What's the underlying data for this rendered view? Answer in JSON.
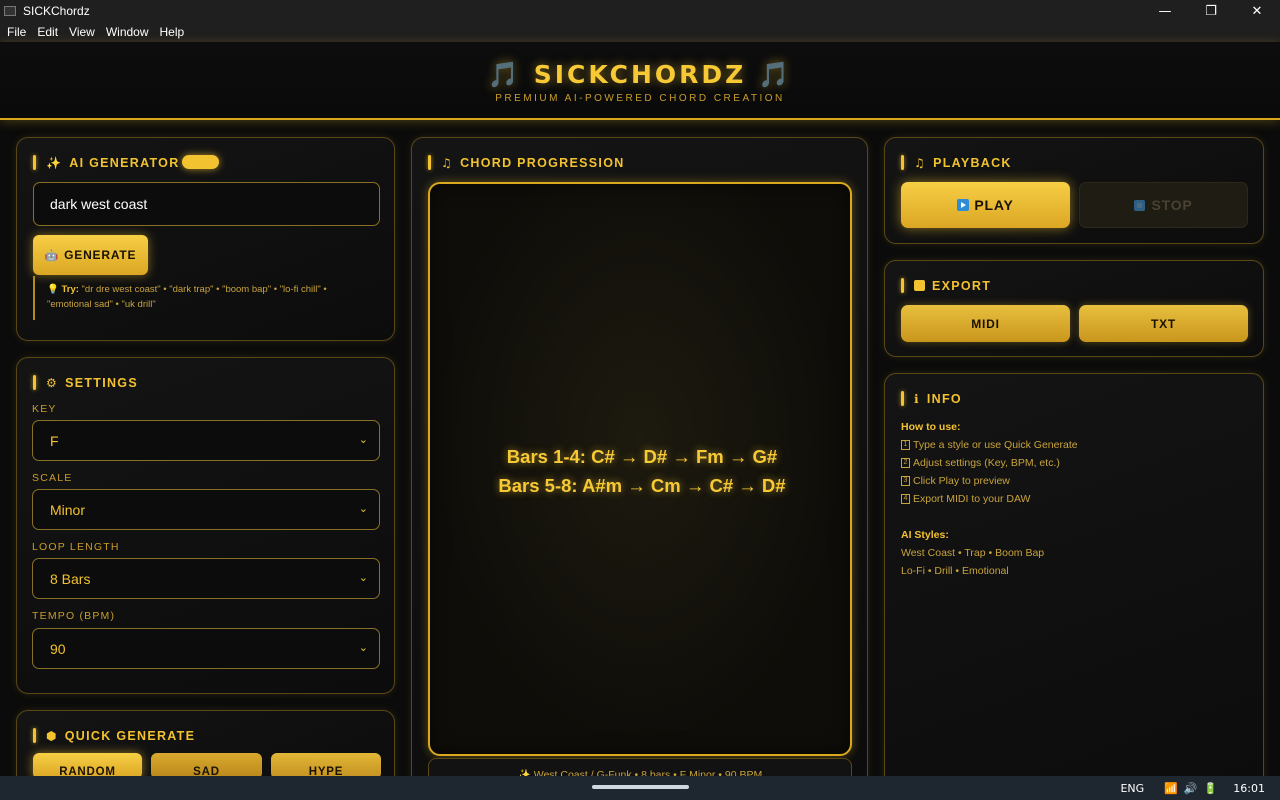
{
  "window": {
    "title": "SICKChordz",
    "controls": {
      "minimize": "—",
      "maximize": "❐",
      "close": "✕"
    }
  },
  "menu": [
    "File",
    "Edit",
    "View",
    "Window",
    "Help"
  ],
  "header": {
    "brand": "🎵 SICKCHORDZ 🎵",
    "tagline": "PREMIUM AI-POWERED CHORD CREATION"
  },
  "ai_generator": {
    "title": "AI GENERATOR",
    "icon": "sparkles-icon",
    "input_value": "dark west coast",
    "generate_label": "GENERATE",
    "tip_label": "Try:",
    "tip_text": " \"dr dre west coast\" • \"dark trap\" • \"boom bap\" • \"lo-fi chill\" • \"emotional sad\" • \"uk drill\""
  },
  "settings": {
    "title": "SETTINGS",
    "fields": [
      {
        "label": "KEY",
        "value": "F"
      },
      {
        "label": "SCALE",
        "value": "Minor"
      },
      {
        "label": "LOOP LENGTH",
        "value": "8 Bars"
      },
      {
        "label": "TEMPO (BPM)",
        "value": "90"
      }
    ]
  },
  "quick_generate": {
    "title": "QUICK GENERATE",
    "buttons": [
      "RANDOM",
      "SAD",
      "HYPE"
    ]
  },
  "chord_progression": {
    "title": "CHORD PROGRESSION",
    "lines": [
      "Bars 1-4: C# → D# → Fm → G#",
      "Bars 5-8: A#m → Cm → C# → D#"
    ],
    "status": "✨ West Coast / G-Funk • 8 bars • F Minor • 90 BPM"
  },
  "playback": {
    "title": "PLAYBACK",
    "play_label": "PLAY",
    "stop_label": "STOP"
  },
  "export": {
    "title": "EXPORT",
    "buttons": [
      "MIDI",
      "TXT"
    ]
  },
  "info": {
    "title": "INFO",
    "how_to_heading": "How to use:",
    "steps": [
      "Type a style or use Quick Generate",
      "Adjust settings (Key, BPM, etc.)",
      "Click Play to preview",
      "Export MIDI to your DAW"
    ],
    "styles_heading": "AI Styles:",
    "styles_lines": [
      "West Coast • Trap • Boom Bap",
      "Lo-Fi • Drill • Emotional"
    ]
  },
  "taskbar": {
    "language": "ENG",
    "time": "16:01"
  },
  "colors": {
    "accent": "#f2c230",
    "background": "#0b0b0b",
    "panel_border": "#5a4716"
  }
}
